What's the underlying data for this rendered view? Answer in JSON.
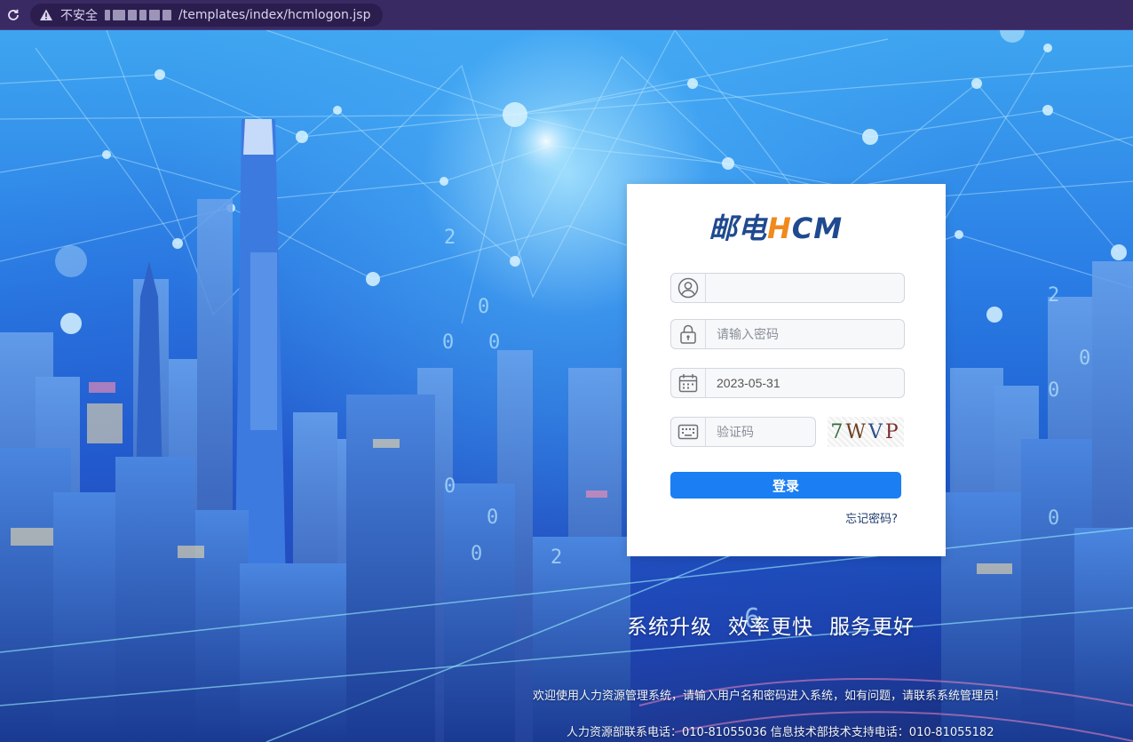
{
  "browser": {
    "security_label": "不安全",
    "url_path": "/templates/index/hcmlogon.jsp"
  },
  "logo": {
    "cn": "邮电",
    "h": "H",
    "cm": "CM"
  },
  "form": {
    "username": {
      "value": "",
      "placeholder": "",
      "icon": "user-icon"
    },
    "password": {
      "value": "",
      "placeholder": "请输入密码",
      "icon": "lock-icon"
    },
    "date": {
      "value": "2023-05-31",
      "icon": "calendar-icon"
    },
    "captcha": {
      "value": "",
      "placeholder": "验证码",
      "icon": "keyboard-icon",
      "image_text": [
        "7",
        "W",
        "V",
        "P"
      ]
    },
    "login_label": "登录",
    "forgot_label": "忘记密码?"
  },
  "slogan": [
    "系统升级",
    "效率更快",
    "服务更好"
  ],
  "footer": {
    "welcome": "欢迎使用人力资源管理系统，请输入用户名和密码进入系统，如有问题，请联系系统管理员!",
    "contact": "人力资源部联系电话：010-81055036 信息技术部技术支持电话：010-81055182"
  },
  "colors": {
    "primary_button": "#1b7ef2",
    "logo_blue": "#1f4a8f",
    "logo_orange": "#f08a1c"
  }
}
